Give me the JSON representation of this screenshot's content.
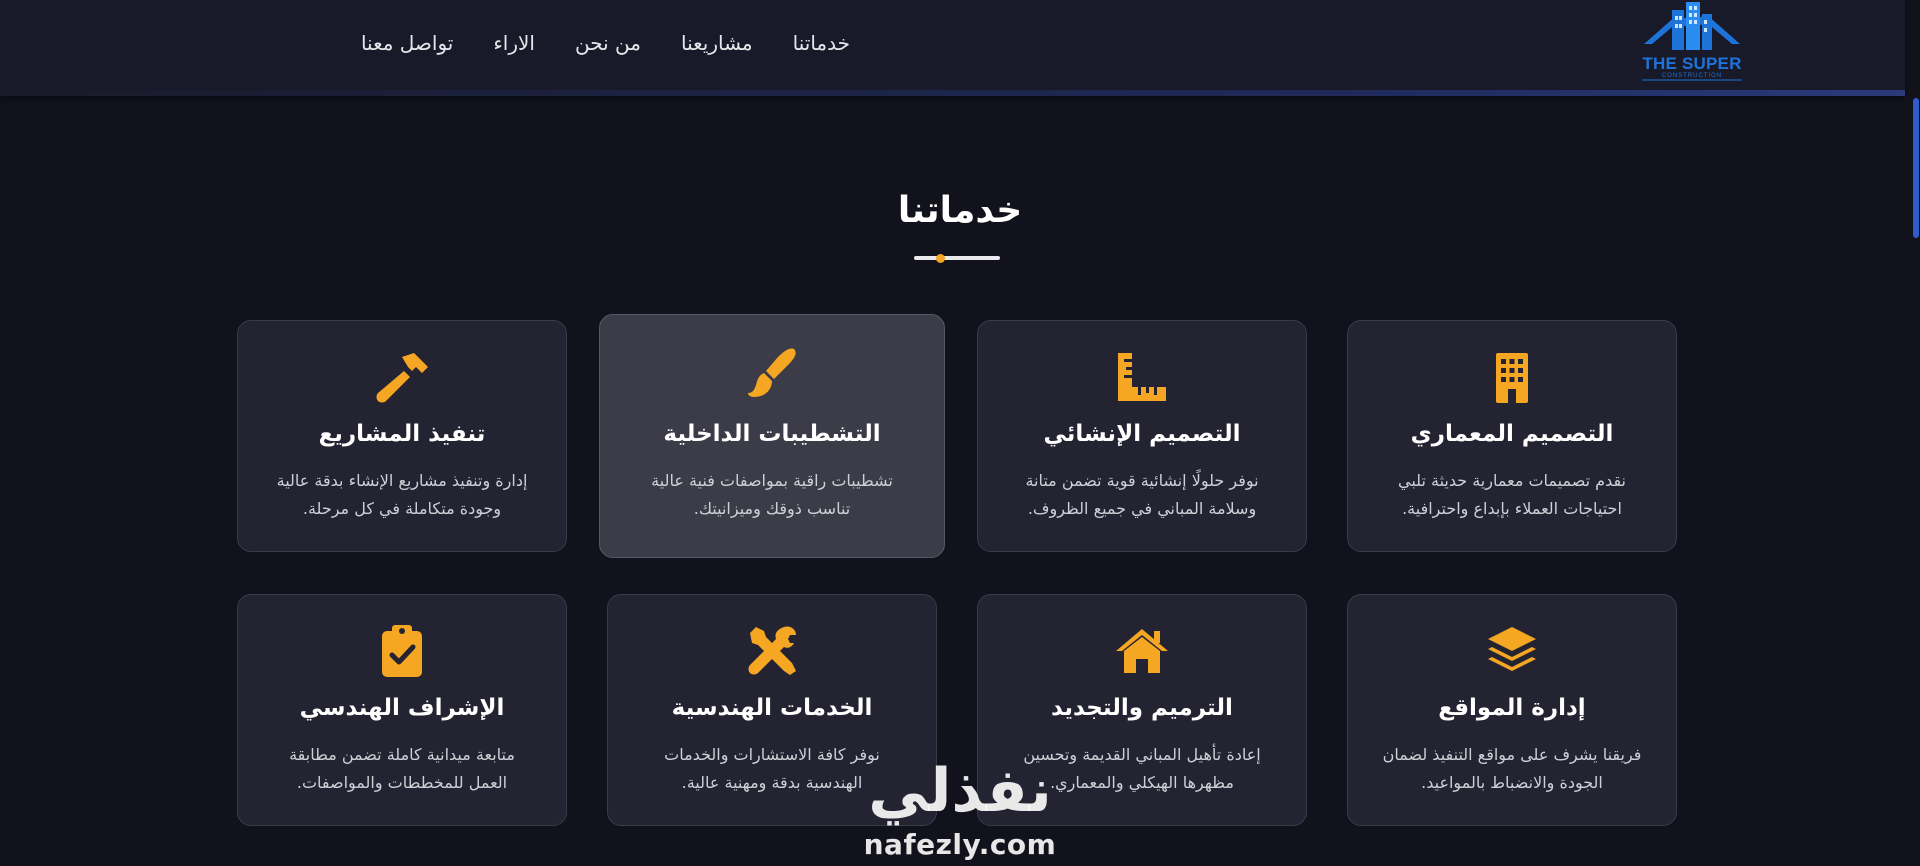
{
  "header": {
    "logo": {
      "text": "THE SUPER",
      "subtext": "CONSTRUCTION",
      "icon": "building-house-icon"
    },
    "nav": [
      {
        "label": "خدماتنا"
      },
      {
        "label": "مشاريعنا"
      },
      {
        "label": "من نحن"
      },
      {
        "label": "الاراء"
      },
      {
        "label": "تواصل معنا"
      }
    ]
  },
  "section": {
    "title": "خدماتنا",
    "accent_color": "#f5a623"
  },
  "services": [
    {
      "icon": "building-icon",
      "title": "التصميم المعماري",
      "description": "نقدم تصميمات معمارية حديثة تلبي احتياجات العملاء بإبداع واحترافية."
    },
    {
      "icon": "ruler-combined-icon",
      "title": "التصميم الإنشائي",
      "description": "نوفر حلولًا إنشائية قوية تضمن متانة وسلامة المباني في جميع الظروف."
    },
    {
      "icon": "paint-brush-icon",
      "title": "التشطيبات الداخلية",
      "description": "تشطيبات راقية بمواصفات فنية عالية تناسب ذوقك وميزانيتك."
    },
    {
      "icon": "hammer-icon",
      "title": "تنفيذ المشاريع",
      "description": "إدارة وتنفيذ مشاريع الإنشاء بدقة عالية وجودة متكاملة في كل مرحلة."
    },
    {
      "icon": "layer-group-icon",
      "title": "إدارة المواقع",
      "description": "فريقنا يشرف على مواقع التنفيذ لضمان الجودة والانضباط بالمواعيد."
    },
    {
      "icon": "home-icon",
      "title": "الترميم والتجديد",
      "description": "إعادة تأهيل المباني القديمة وتحسين مظهرها الهيكلي والمعماري."
    },
    {
      "icon": "tools-icon",
      "title": "الخدمات الهندسية",
      "description": "نوفر كافة الاستشارات والخدمات الهندسية بدقة ومهنية عالية."
    },
    {
      "icon": "clipboard-check-icon",
      "title": "الإشراف الهندسي",
      "description": "متابعة ميدانية كاملة تضمن مطابقة العمل للمخططات والمواصفات."
    }
  ],
  "watermark": {
    "arabic": "نفذلي",
    "latin": "nafezly.com"
  }
}
